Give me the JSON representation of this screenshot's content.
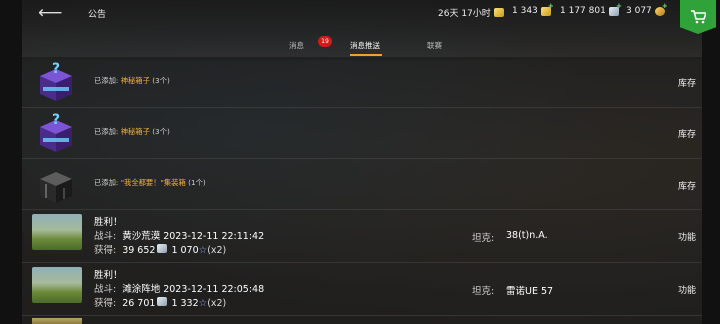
{
  "header": {
    "title": "公告",
    "timer": "26天 17小时",
    "gold": "1 343",
    "silver": "1 177 801",
    "free_xp": "3 077"
  },
  "tabs": [
    {
      "label": "消息",
      "badge": "19"
    },
    {
      "label": "消息推送"
    },
    {
      "label": "联赛"
    }
  ],
  "items": [
    {
      "prefix": "已添加:",
      "name": "神秘箱子",
      "count": "(3个)",
      "action": "库存",
      "icon": "mystery-box-icon"
    },
    {
      "prefix": "已添加:",
      "name": "神秘箱子",
      "count": "(3个)",
      "action": "库存",
      "icon": "mystery-box-icon"
    },
    {
      "prefix": "已添加:",
      "name": "\"我全都要！\"集装箱",
      "count": "(1个)",
      "action": "库存",
      "icon": "container-icon"
    }
  ],
  "battles": [
    {
      "title": "胜利！",
      "battle_label": "战斗:",
      "battle_value": "黄沙荒漠 2023-12-11 22:11:42",
      "earned_label": "获得:",
      "credits": "39 652",
      "xp": "1 070",
      "multiplier": "(x2)",
      "tank_label": "坦克:",
      "tank_value": "38(t)n.A.",
      "action": "功能"
    },
    {
      "title": "胜利！",
      "battle_label": "战斗:",
      "battle_value": "滩涂阵地 2023-12-11 22:05:48",
      "earned_label": "获得:",
      "credits": "26 701",
      "xp": "1 332",
      "multiplier": "(x2)",
      "tank_label": "坦克:",
      "tank_value": "雷诺UE 57",
      "action": "功能"
    }
  ],
  "colors": {
    "accent": "#f0a12a",
    "item_name": "#f0b13a",
    "badge": "#d11a1a",
    "shop": "#2fa33a"
  }
}
